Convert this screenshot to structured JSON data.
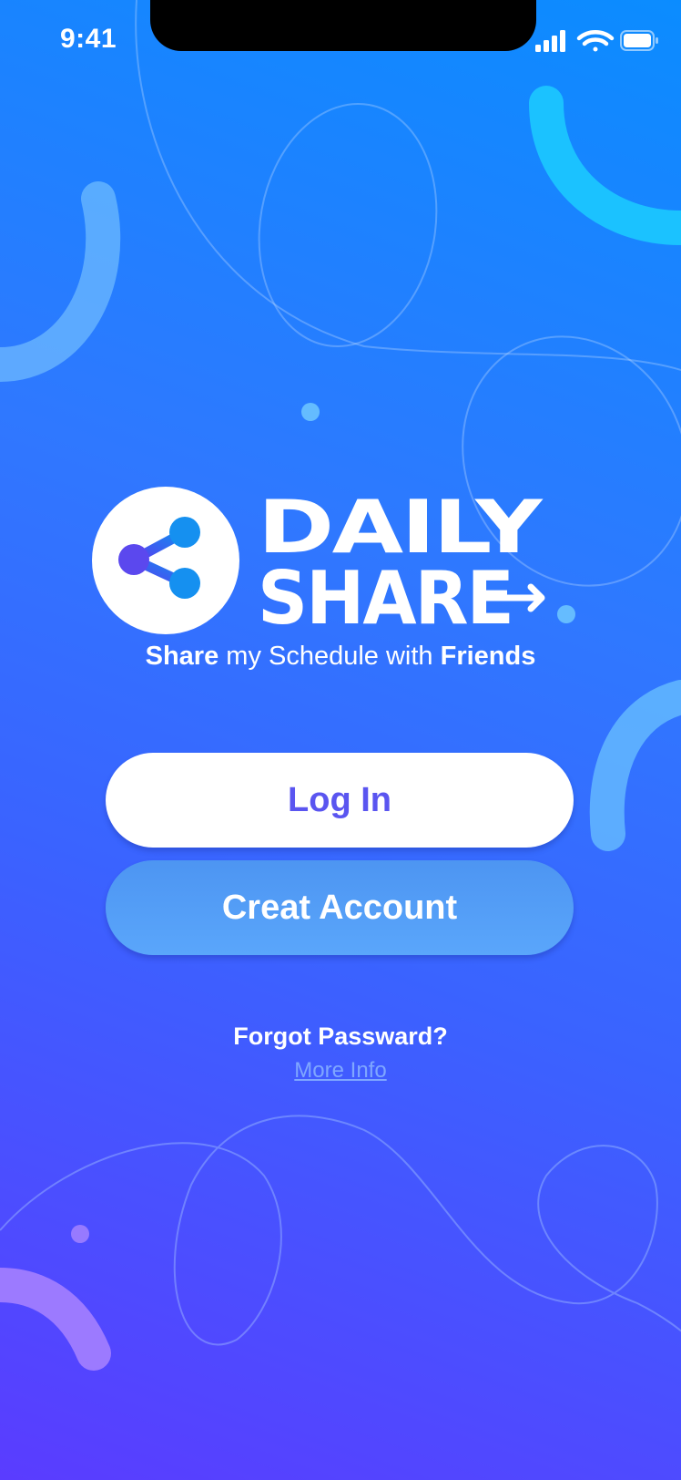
{
  "status_bar": {
    "time": "9:41",
    "icons": [
      "signal-icon",
      "wifi-icon",
      "battery-icon"
    ]
  },
  "logo": {
    "icon": "share-icon",
    "wordmark_line1": "DAILY",
    "wordmark_line2": "SHARE"
  },
  "tagline": {
    "part1": "Share",
    "part2": " my Schedule with ",
    "part3": "Friends"
  },
  "buttons": {
    "login": "Log In",
    "create_account": "Creat Account"
  },
  "links": {
    "forgot_password": "Forgot Passward?",
    "more_info": "More Info"
  },
  "colors": {
    "gradient_top": "#0b8cff",
    "gradient_bottom": "#5a3cff",
    "login_text": "#5a55f0",
    "create_button": "#55a0f8",
    "link": "#7fa7ff"
  }
}
